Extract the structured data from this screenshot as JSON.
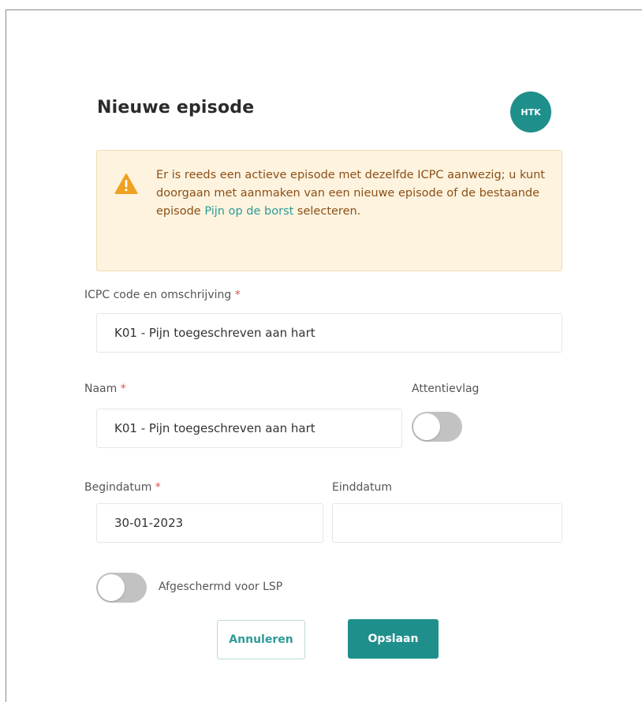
{
  "dialog": {
    "title": "Nieuwe episode",
    "avatar_initials": "HTK"
  },
  "alert": {
    "text_before_link": "Er is reeds een actieve episode met dezelfde ICPC aanwezig; u kunt doorgaan met aanmaken van een nieuwe episode of de bestaande episode ",
    "link_text": "Pijn op de borst",
    "text_after_link": " selecteren.",
    "icon": "warning-triangle-icon"
  },
  "fields": {
    "icpc": {
      "label": "ICPC code en omschrijving",
      "required_mark": "*",
      "value": "K01 - Pijn toegeschreven aan hart"
    },
    "naam": {
      "label": "Naam",
      "required_mark": "*",
      "value": "K01 - Pijn toegeschreven aan hart"
    },
    "attentievlag": {
      "label": "Attentievlag",
      "state": "off"
    },
    "begindatum": {
      "label": "Begindatum",
      "required_mark": "*",
      "value": "30-01-2023"
    },
    "einddatum": {
      "label": "Einddatum",
      "value": ""
    },
    "afgeschermd": {
      "label": "Afgeschermd voor LSP",
      "state": "off"
    }
  },
  "buttons": {
    "cancel_label": "Annuleren",
    "save_label": "Opslaan"
  },
  "colors": {
    "primary": "#1f8f8c",
    "warning_bg": "#fdf3df",
    "warning_text": "#8c4f16",
    "warning_icon": "#f0a020",
    "required": "#d9534f"
  }
}
